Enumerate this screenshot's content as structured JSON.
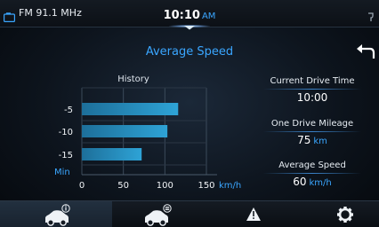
{
  "status_bar": {
    "radio": "FM 91.1 MHz",
    "time": "10:10",
    "ampm": "AM",
    "icons": [
      "radio-icon",
      "signal-icon"
    ]
  },
  "page": {
    "title": "Average Speed",
    "back_icon": "back-arrow-icon"
  },
  "history_label": "History",
  "chart_data": {
    "type": "bar",
    "orientation": "horizontal",
    "title": "History",
    "categories": [
      "-5",
      "-10",
      "-15"
    ],
    "category_unit": "Min",
    "values": [
      116,
      103,
      72
    ],
    "xlabel": "km/h",
    "xticks": [
      "0",
      "50",
      "100",
      "150"
    ],
    "xlim": [
      0,
      150
    ],
    "grid": true,
    "color": "#2ea3d6"
  },
  "stats": [
    {
      "label": "Current Drive Time",
      "value": "10:00",
      "unit": ""
    },
    {
      "label": "One Drive Mileage",
      "value": "75",
      "unit": "km"
    },
    {
      "label": "Average Speed",
      "value": "60",
      "unit": "km/h"
    }
  ],
  "nav": {
    "items": [
      "vehicle-info-icon",
      "vehicle-settings-icon",
      "warning-icon",
      "settings-gear-icon"
    ],
    "active": 0
  },
  "colors": {
    "accent": "#3aa6ff",
    "bar": "#2ea3d6",
    "background": "#0d141d"
  }
}
